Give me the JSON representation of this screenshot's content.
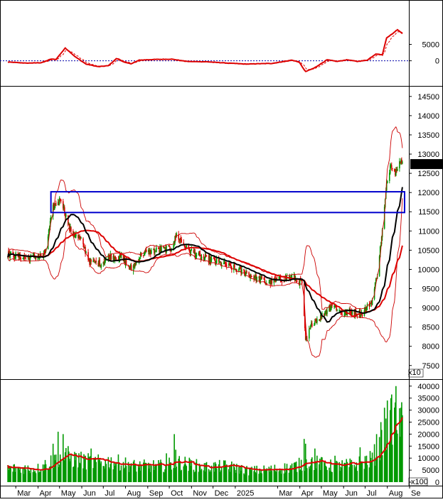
{
  "chart_data": {
    "type": "stock-chart",
    "price_panel": {
      "type": "candlestick",
      "ylim": [
        7200,
        14700
      ],
      "y_ticks": [
        7500,
        8000,
        8500,
        9000,
        9500,
        10000,
        10500,
        11000,
        11500,
        12000,
        12500,
        13000,
        13500,
        14000,
        14500
      ],
      "axis_multiplier_label": "x10",
      "last_price_label": "127400.0",
      "last_price_value": 12740,
      "highlight_box": {
        "x_start": "2024-04-19",
        "x_end": "2025-08-25",
        "y_low": 11480,
        "y_high": 12020,
        "color": "#0000cc"
      },
      "series": [
        {
          "name": "",
          "kind": "sma_long",
          "color": "#dd0000"
        },
        {
          "name": "",
          "kind": "sma_short",
          "color": "#000000"
        },
        {
          "name": "",
          "kind": "bollinger_bands",
          "color": "#cc0000"
        }
      ],
      "anchor_closes": [
        [
          "2024-02-20",
          10400
        ],
        [
          "2024-03-15",
          10300
        ],
        [
          "2024-04-10",
          10350
        ],
        [
          "2024-04-22",
          11600
        ],
        [
          "2024-05-03",
          11850
        ],
        [
          "2024-05-15",
          11050
        ],
        [
          "2024-05-31",
          10750
        ],
        [
          "2024-06-12",
          10200
        ],
        [
          "2024-06-28",
          10150
        ],
        [
          "2024-07-10",
          10350
        ],
        [
          "2024-07-26",
          10300
        ],
        [
          "2024-08-09",
          10000
        ],
        [
          "2024-08-23",
          10400
        ],
        [
          "2024-09-13",
          10500
        ],
        [
          "2024-10-04",
          10550
        ],
        [
          "2024-10-11",
          10900
        ],
        [
          "2024-10-25",
          10550
        ],
        [
          "2024-11-15",
          10300
        ],
        [
          "2024-12-06",
          10200
        ],
        [
          "2024-12-27",
          10050
        ],
        [
          "2025-01-17",
          9900
        ],
        [
          "2025-02-14",
          9650
        ],
        [
          "2025-03-07",
          9750
        ],
        [
          "2025-03-21",
          9800
        ],
        [
          "2025-04-04",
          9650
        ],
        [
          "2025-04-09",
          8100
        ],
        [
          "2025-04-18",
          8600
        ],
        [
          "2025-05-02",
          8800
        ],
        [
          "2025-05-16",
          9100
        ],
        [
          "2025-05-30",
          8850
        ],
        [
          "2025-06-13",
          8900
        ],
        [
          "2025-06-27",
          8850
        ],
        [
          "2025-07-11",
          9200
        ],
        [
          "2025-07-18",
          9900
        ],
        [
          "2025-07-25",
          11000
        ],
        [
          "2025-07-31",
          12200
        ],
        [
          "2025-08-06",
          12800
        ],
        [
          "2025-08-12",
          12500
        ],
        [
          "2025-08-18",
          12900
        ],
        [
          "2025-08-22",
          12740
        ]
      ]
    },
    "oscillator_panel": {
      "type": "line",
      "ylim": [
        -7000,
        18500
      ],
      "y_ticks": [
        0,
        5000
      ],
      "zero_line": true,
      "series": [
        {
          "name": "",
          "kind": "oscillator",
          "color": "#dd0000",
          "style": "solid"
        },
        {
          "name": "",
          "kind": "signal",
          "color": "#dd0000",
          "style": "dashed"
        }
      ],
      "points": [
        [
          "2024-02-20",
          -400
        ],
        [
          "2024-03-15",
          -700
        ],
        [
          "2024-04-05",
          -600
        ],
        [
          "2024-04-19",
          500
        ],
        [
          "2024-04-26",
          400
        ],
        [
          "2024-05-09",
          3900
        ],
        [
          "2024-05-23",
          1200
        ],
        [
          "2024-06-07",
          -1000
        ],
        [
          "2024-06-24",
          -1800
        ],
        [
          "2024-07-08",
          -1500
        ],
        [
          "2024-07-20",
          800
        ],
        [
          "2024-07-31",
          -500
        ],
        [
          "2024-08-09",
          -900
        ],
        [
          "2024-08-20",
          200
        ],
        [
          "2024-09-10",
          400
        ],
        [
          "2024-10-04",
          500
        ],
        [
          "2024-10-25",
          -200
        ],
        [
          "2024-11-22",
          -300
        ],
        [
          "2024-12-20",
          -700
        ],
        [
          "2025-01-17",
          -1000
        ],
        [
          "2025-02-21",
          -800
        ],
        [
          "2025-03-21",
          200
        ],
        [
          "2025-03-31",
          -400
        ],
        [
          "2025-04-09",
          -3300
        ],
        [
          "2025-04-21",
          -2200
        ],
        [
          "2025-05-09",
          300
        ],
        [
          "2025-05-23",
          -200
        ],
        [
          "2025-06-06",
          300
        ],
        [
          "2025-06-20",
          -200
        ],
        [
          "2025-07-04",
          200
        ],
        [
          "2025-07-16",
          2100
        ],
        [
          "2025-07-25",
          1800
        ],
        [
          "2025-07-31",
          7000
        ],
        [
          "2025-08-08",
          8200
        ],
        [
          "2025-08-15",
          9500
        ],
        [
          "2025-08-22",
          8300
        ]
      ]
    },
    "volume_panel": {
      "type": "bar",
      "ylim": [
        0,
        42000
      ],
      "y_ticks": [
        0,
        5000,
        10000,
        15000,
        20000,
        25000,
        30000,
        35000,
        40000
      ],
      "axis_multiplier_label": "x100",
      "bar_color": "#009900",
      "ma_color": "#dd0000",
      "anchor_volumes": [
        [
          "2024-02-20",
          6000
        ],
        [
          "2024-04-01",
          6000
        ],
        [
          "2024-05-02",
          11000
        ],
        [
          "2024-05-24",
          10000
        ],
        [
          "2024-06-20",
          8500
        ],
        [
          "2024-07-15",
          9000
        ],
        [
          "2024-08-15",
          7000
        ],
        [
          "2024-09-20",
          7000
        ],
        [
          "2024-10-15",
          8500
        ],
        [
          "2024-11-20",
          6500
        ],
        [
          "2024-12-20",
          7000
        ],
        [
          "2025-01-20",
          5000
        ],
        [
          "2025-02-20",
          5500
        ],
        [
          "2025-03-20",
          6500
        ],
        [
          "2025-04-15",
          9000
        ],
        [
          "2025-05-15",
          7000
        ],
        [
          "2025-06-15",
          7500
        ],
        [
          "2025-07-10",
          10000
        ],
        [
          "2025-07-25",
          17000
        ],
        [
          "2025-08-08",
          28000
        ],
        [
          "2025-08-22",
          25000
        ]
      ],
      "spikes": [
        [
          "2024-04-22",
          16000
        ],
        [
          "2024-04-29",
          21000
        ],
        [
          "2024-05-06",
          20000
        ],
        [
          "2024-05-13",
          15000
        ],
        [
          "2024-06-14",
          14000
        ],
        [
          "2024-09-27",
          12000
        ],
        [
          "2024-10-08",
          20000
        ],
        [
          "2024-10-10",
          13500
        ],
        [
          "2025-04-07",
          18000
        ],
        [
          "2025-04-09",
          16000
        ],
        [
          "2025-04-22",
          14000
        ],
        [
          "2025-05-20",
          11000
        ],
        [
          "2025-06-24",
          14500
        ],
        [
          "2025-07-17",
          20000
        ],
        [
          "2025-07-23",
          25000
        ],
        [
          "2025-07-28",
          31000
        ],
        [
          "2025-08-01",
          34000
        ],
        [
          "2025-08-05",
          30000
        ],
        [
          "2025-08-13",
          40000
        ],
        [
          "2025-08-20",
          31000
        ]
      ]
    },
    "x_axis": {
      "start_date": "2024-02-08",
      "end_date": "2025-08-31",
      "tick_labels": [
        {
          "label": "Mar",
          "date": "2024-03-01"
        },
        {
          "label": "Apr",
          "date": "2024-04-01"
        },
        {
          "label": "May",
          "date": "2024-05-01"
        },
        {
          "label": "Jun",
          "date": "2024-06-01"
        },
        {
          "label": "Jul",
          "date": "2024-07-01"
        },
        {
          "label": "Aug",
          "date": "2024-08-01"
        },
        {
          "label": "Sep",
          "date": "2024-09-01"
        },
        {
          "label": "Oct",
          "date": "2024-10-01"
        },
        {
          "label": "Nov",
          "date": "2024-11-01"
        },
        {
          "label": "Dec",
          "date": "2024-12-01"
        },
        {
          "label": "2025",
          "date": "2025-01-01"
        },
        {
          "label": "Mar",
          "date": "2025-03-01"
        },
        {
          "label": "Apr",
          "date": "2025-04-01"
        },
        {
          "label": "May",
          "date": "2025-05-01"
        },
        {
          "label": "Jun",
          "date": "2025-06-01"
        },
        {
          "label": "Jul",
          "date": "2025-07-01"
        },
        {
          "label": "Aug",
          "date": "2025-08-01"
        },
        {
          "label": "Se",
          "date": "2025-09-01"
        }
      ]
    },
    "colors": {
      "candle_up": "#009900",
      "candle_down": "#dd0000",
      "sma_long": "#dd0000",
      "sma_short": "#000000",
      "bands": "#cc0000",
      "zero_line": "#0000aa",
      "box": "#0000cc",
      "price_label_bg": "#000000",
      "price_label_fg": "#00ff00"
    }
  }
}
